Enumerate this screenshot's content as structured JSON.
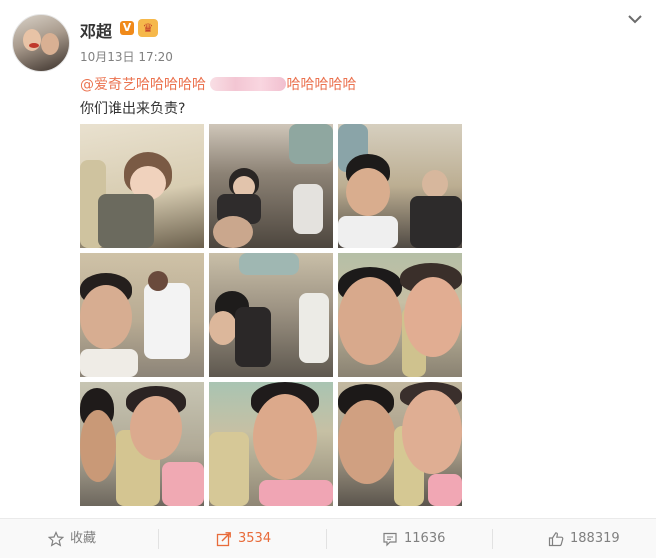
{
  "post": {
    "author": "邓超",
    "time": "10月13日 17:20",
    "mention": "@爱奇艺哈哈哈哈哈",
    "mention_tail": "哈哈哈哈哈",
    "text": "你们谁出来负责?"
  },
  "badges": {
    "verified": "V",
    "crown": "♛"
  },
  "icons": [
    "chevron-down-icon",
    "star-icon",
    "share-icon",
    "comment-icon",
    "like-icon"
  ],
  "actions": {
    "favorite_label": "收藏",
    "share_count": "3534",
    "comment_count": "11636",
    "like_count": "188319"
  },
  "colors": {
    "accent": "#eb7350",
    "verified": "#f08a1a"
  }
}
